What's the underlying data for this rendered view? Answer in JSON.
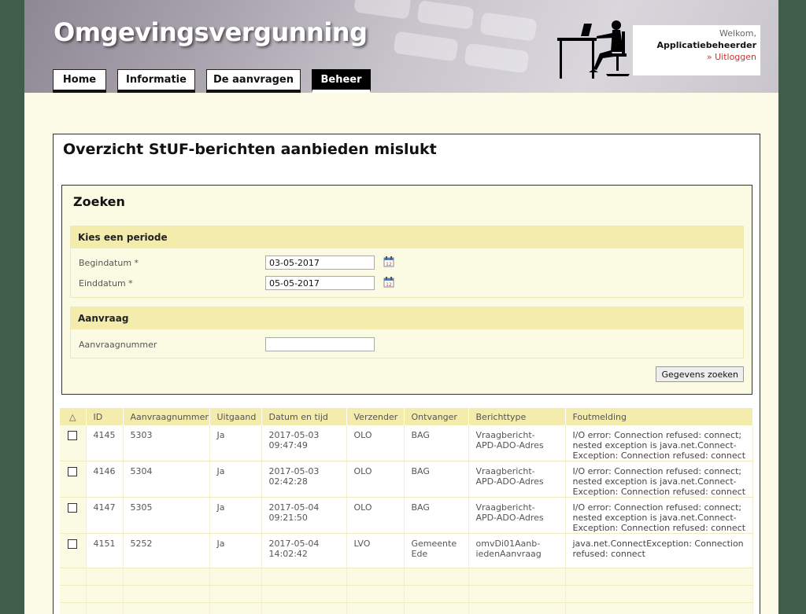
{
  "header": {
    "app_title": "Omgevingsvergunning",
    "nav": [
      "Home",
      "Informatie",
      "De aanvragen",
      "Beheer"
    ],
    "active_nav": "Beheer",
    "welcome": "Welkom,",
    "user": "Applicatiebeheerder",
    "logout": "» Uitloggen"
  },
  "main": {
    "title": "Overzicht StUF-berichten aanbieden mislukt"
  },
  "search": {
    "title": "Zoeken",
    "period_section": "Kies een periode",
    "begindatum_label": "Begindatum *",
    "begindatum_value": "03-05-2017",
    "einddatum_label": "Einddatum *",
    "einddatum_value": "05-05-2017",
    "aanvraag_section": "Aanvraag",
    "aanvraagnummer_label": "Aanvraagnummer",
    "aanvraagnummer_value": "",
    "button": "Gegevens zoeken"
  },
  "table": {
    "sort_indicator": "△",
    "columns": [
      "ID",
      "Aanvraagnummer",
      "Uitgaand",
      "Datum en tijd",
      "Verzender",
      "Ontvanger",
      "Berichttype",
      "Foutmelding"
    ],
    "rows": [
      {
        "id": "4145",
        "aanvraagnummer": "5303",
        "uitgaand": "Ja",
        "datum_line1": "2017-05-03",
        "datum_line2": "09:47:49",
        "verzender": "OLO",
        "ontvanger_line1": "BAG",
        "ontvanger_line2": "",
        "berichttype_line1": "Vraagbericht-",
        "berichttype_line2": "APD-ADO-Adres",
        "fout_line1": "I/O error: Connection refused: connect;",
        "fout_line2": "nested exception is java.net.Connect-",
        "fout_line3": "Exception: Connection refused: connect"
      },
      {
        "id": "4146",
        "aanvraagnummer": "5304",
        "uitgaand": "Ja",
        "datum_line1": "2017-05-03",
        "datum_line2": "02:42:28",
        "verzender": "OLO",
        "ontvanger_line1": "BAG",
        "ontvanger_line2": "",
        "berichttype_line1": "Vraagbericht-",
        "berichttype_line2": "APD-ADO-Adres",
        "fout_line1": "I/O error: Connection refused: connect;",
        "fout_line2": "nested exception is java.net.Connect-",
        "fout_line3": "Exception: Connection refused: connect"
      },
      {
        "id": "4147",
        "aanvraagnummer": "5305",
        "uitgaand": "Ja",
        "datum_line1": "2017-05-04",
        "datum_line2": "09:21:50",
        "verzender": "OLO",
        "ontvanger_line1": "BAG",
        "ontvanger_line2": "",
        "berichttype_line1": "Vraagbericht-",
        "berichttype_line2": "APD-ADO-Adres",
        "fout_line1": "I/O error: Connection refused: connect;",
        "fout_line2": "nested exception is java.net.Connect-",
        "fout_line3": "Exception: Connection refused: connect"
      },
      {
        "id": "4151",
        "aanvraagnummer": "5252",
        "uitgaand": "Ja",
        "datum_line1": "2017-05-04",
        "datum_line2": "14:02:42",
        "verzender": "LVO",
        "ontvanger_line1": "Gemeente",
        "ontvanger_line2": "Ede",
        "berichttype_line1": "omvDi01Aanb-",
        "berichttype_line2": "iedenAanvraag",
        "fout_line1": "java.net.ConnectException: Connection",
        "fout_line2": "refused: connect",
        "fout_line3": ""
      }
    ]
  }
}
